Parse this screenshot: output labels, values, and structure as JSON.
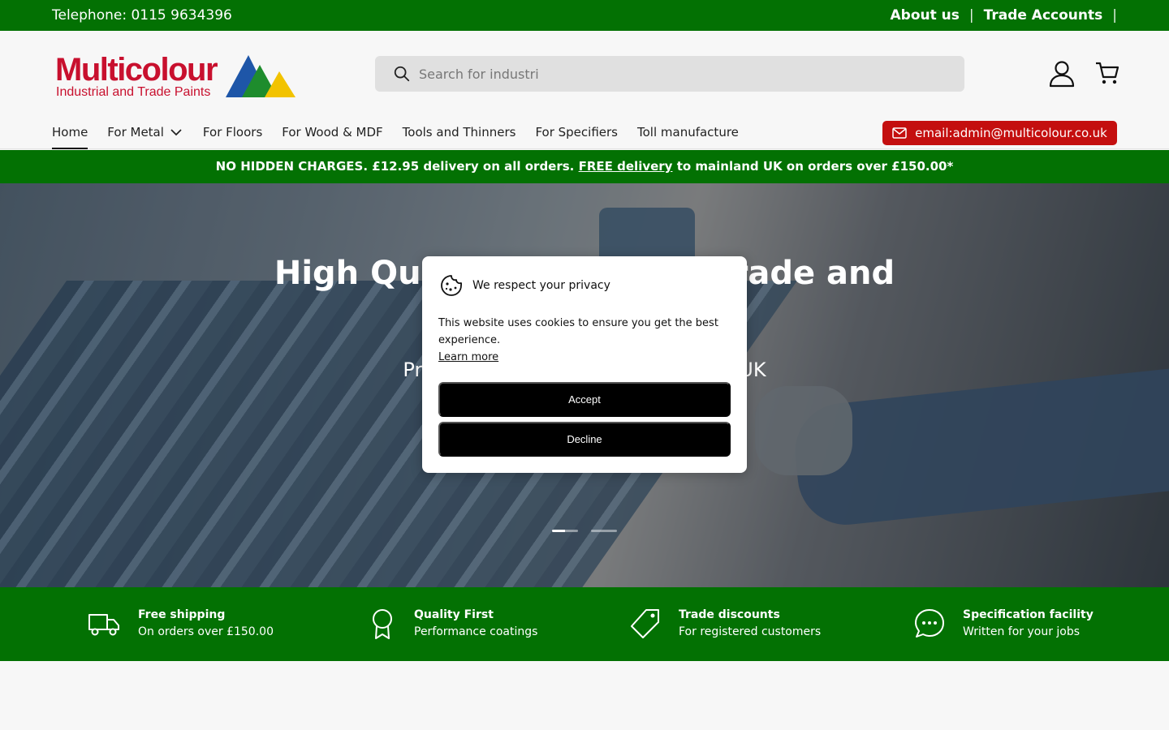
{
  "topbar": {
    "phone": "Telephone: 0115 9634396",
    "links": [
      "About us",
      "Trade Accounts"
    ]
  },
  "logo": {
    "brand": "Multicolour",
    "tagline": "Industrial and Trade Paints"
  },
  "search": {
    "value": "",
    "placeholder": "Search for industri"
  },
  "header_icons": [
    "account-icon",
    "cart-icon"
  ],
  "nav": {
    "items": [
      "Home",
      "For Metal",
      "For Floors",
      "For Wood & MDF",
      "Tools and Thinners",
      "For Specifiers",
      "Toll manufacture"
    ],
    "active": "Home"
  },
  "email_button": "email:admin@multicolour.co.uk",
  "announcement": {
    "before": "NO HIDDEN CHARGES. £12.95 delivery on all orders.",
    "link": "FREE delivery",
    "after": "to mainland UK on orders over £150.00*"
  },
  "hero": {
    "heading": "High Quality Industrial, Trade and",
    "subheading": "Primers and Coatings Made in the UK"
  },
  "features": [
    {
      "icon": "truck-icon",
      "title": "Free shipping",
      "subtitle": "On orders over £150.00"
    },
    {
      "icon": "award-icon",
      "title": "Quality First",
      "subtitle": "Performance coatings"
    },
    {
      "icon": "tag-icon",
      "title": "Trade discounts",
      "subtitle": "For registered customers"
    },
    {
      "icon": "chat-icon",
      "title": "Specification facility",
      "subtitle": "Written for your jobs"
    }
  ],
  "cookie": {
    "title": "We respect your privacy",
    "text": "This website uses cookies to ensure you get the best experience.",
    "learn_more": "Learn more",
    "accept": "Accept",
    "decline": "Decline"
  },
  "colors": {
    "green": "#037103",
    "red": "#c40f0f",
    "brand_red": "#c8102e"
  }
}
